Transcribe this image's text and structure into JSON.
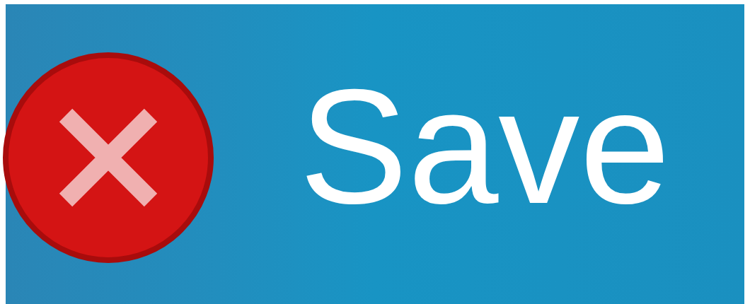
{
  "button": {
    "label": "Save"
  }
}
